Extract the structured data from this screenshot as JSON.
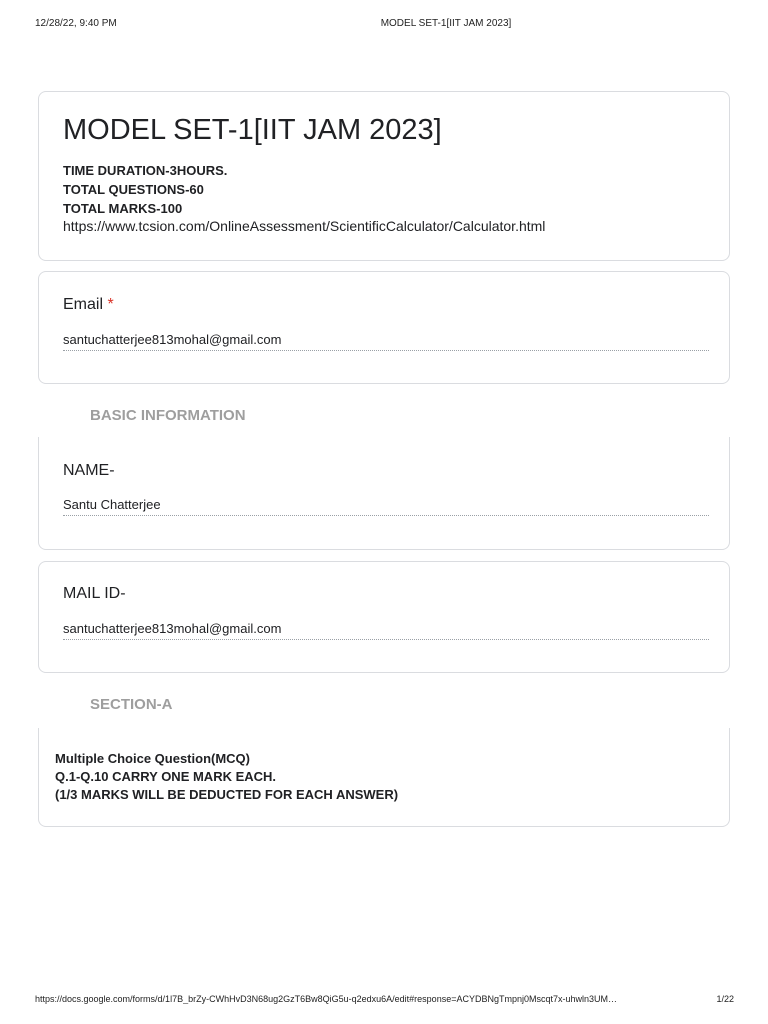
{
  "print_header": {
    "date": "12/28/22, 9:40 PM",
    "title": "MODEL SET-1[IIT JAM 2023]"
  },
  "form": {
    "title": "MODEL SET-1[IIT JAM 2023]",
    "description": [
      "TIME DURATION-3HOURS.",
      "TOTAL QUESTIONS-60",
      "TOTAL MARKS-100"
    ],
    "link": "https://www.tcsion.com/OnlineAssessment/ScientificCalculator/Calculator.html"
  },
  "email_question": {
    "label": "Email",
    "required_mark": "*",
    "answer": "santuchatterjee813mohal@gmail.com"
  },
  "basic_info": {
    "header": "BASIC INFORMATION",
    "name_label": "NAME-",
    "name_answer": "Santu Chatterjee",
    "mail_label": "MAIL ID-",
    "mail_answer": "santuchatterjee813mohal@gmail.com"
  },
  "section_a": {
    "header": "SECTION-A",
    "lines": [
      "Multiple Choice Question(MCQ)",
      "Q.1-Q.10 CARRY ONE MARK EACH.",
      "(1/3 MARKS WILL BE DEDUCTED FOR EACH ANSWER)"
    ]
  },
  "print_footer": {
    "url": "https://docs.google.com/forms/d/1l7B_brZy-CWhHvD3N68ug2GzT6Bw8QiG5u-q2edxu6A/edit#response=ACYDBNgTmpnj0Mscqt7x-uhwln3UM…",
    "page": "1/22"
  }
}
